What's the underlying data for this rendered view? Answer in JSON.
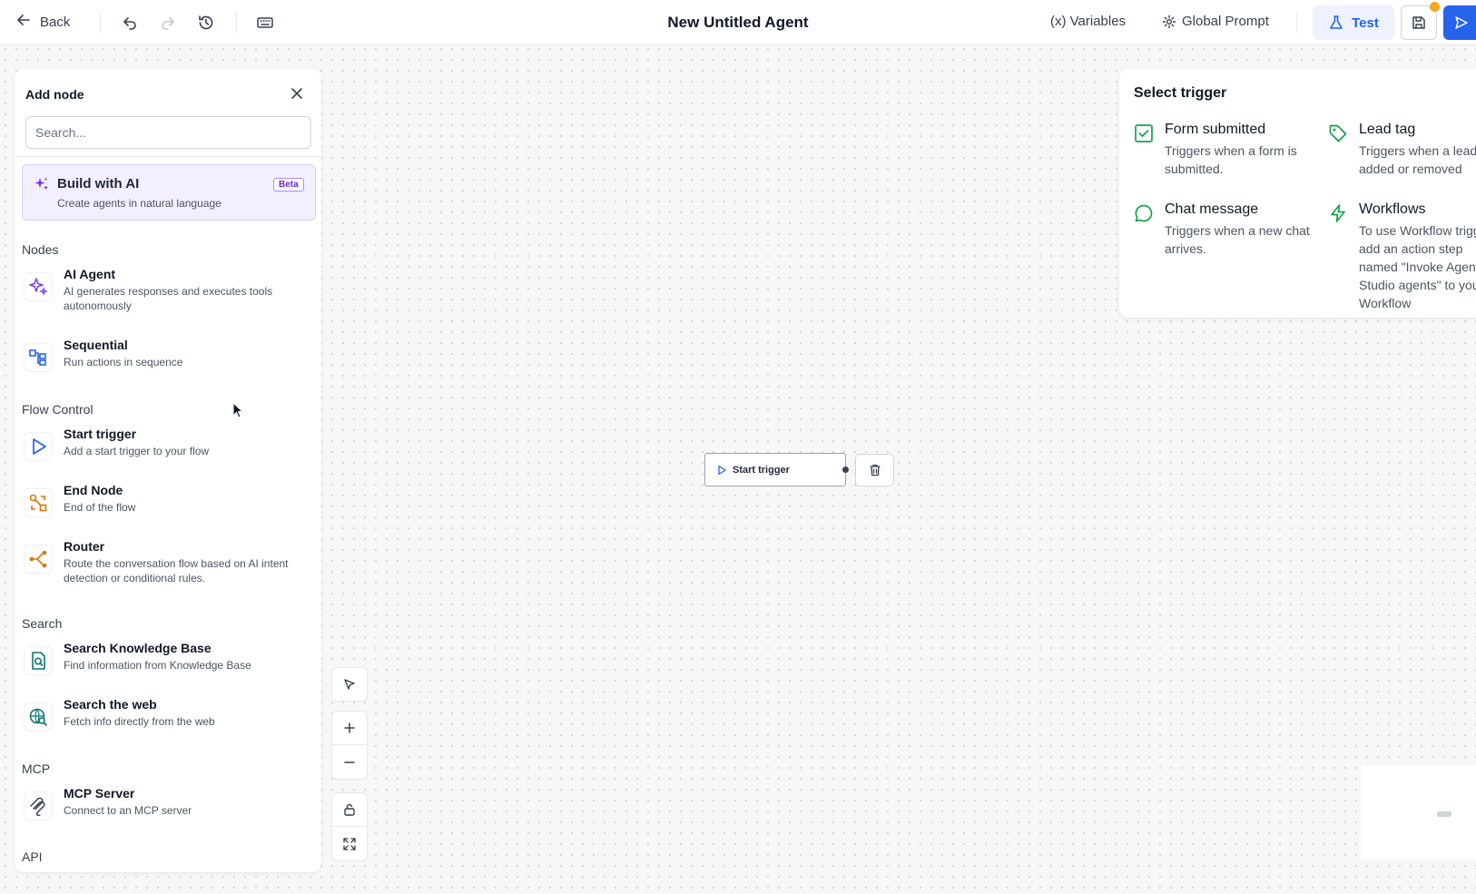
{
  "topbar": {
    "back_label": "Back",
    "title": "New Untitled Agent",
    "variables_label": "(x) Variables",
    "global_prompt_label": "Global Prompt",
    "test_label": "Test"
  },
  "add_node_panel": {
    "title": "Add node",
    "search_placeholder": "Search...",
    "build_ai": {
      "title": "Build with AI",
      "description": "Create agents in natural language",
      "badge": "Beta"
    },
    "sections": {
      "nodes": "Nodes",
      "flow_control": "Flow Control",
      "search": "Search",
      "mcp": "MCP",
      "api": "API"
    },
    "items": {
      "ai_agent": {
        "name": "AI Agent",
        "description": "AI generates responses and executes tools autonomously",
        "icon": "sparkle-icon"
      },
      "sequential": {
        "name": "Sequential",
        "description": "Run actions in sequence",
        "icon": "sequence-icon"
      },
      "start_trigger": {
        "name": "Start trigger",
        "description": "Add a start trigger to your flow",
        "icon": "play-icon"
      },
      "end_node": {
        "name": "End Node",
        "description": "End of the flow",
        "icon": "end-node-icon"
      },
      "router": {
        "name": "Router",
        "description": "Route the conversation flow based on AI intent detection or conditional rules.",
        "icon": "router-icon"
      },
      "search_kb": {
        "name": "Search Knowledge Base",
        "description": "Find information from Knowledge Base",
        "icon": "knowledge-search-icon"
      },
      "search_web": {
        "name": "Search the web",
        "description": "Fetch info directly from the web",
        "icon": "web-search-icon"
      },
      "mcp_server": {
        "name": "MCP Server",
        "description": "Connect to an MCP server",
        "icon": "mcp-icon"
      }
    }
  },
  "canvas": {
    "start_node_label": "Start trigger"
  },
  "trigger_panel": {
    "title": "Select trigger",
    "triggers": {
      "form": {
        "name": "Form submitted",
        "description": "Triggers when a form is submitted."
      },
      "lead": {
        "name": "Lead tag",
        "description": "Triggers when a lead is added or removed"
      },
      "chat": {
        "name": "Chat message",
        "description": "Triggers when a new chat arrives."
      },
      "workflows": {
        "name": "Workflows",
        "description": "To use Workflow triggers, add an action step named \"Invoke Agent Studio agents\" to your Workflow"
      }
    }
  },
  "colors": {
    "accent_blue": "#2563eb",
    "ai_purple": "#7c3aed",
    "trigger_green": "#16a34a",
    "flow_orange": "#d97706",
    "notification_dot": "#f5a623"
  }
}
